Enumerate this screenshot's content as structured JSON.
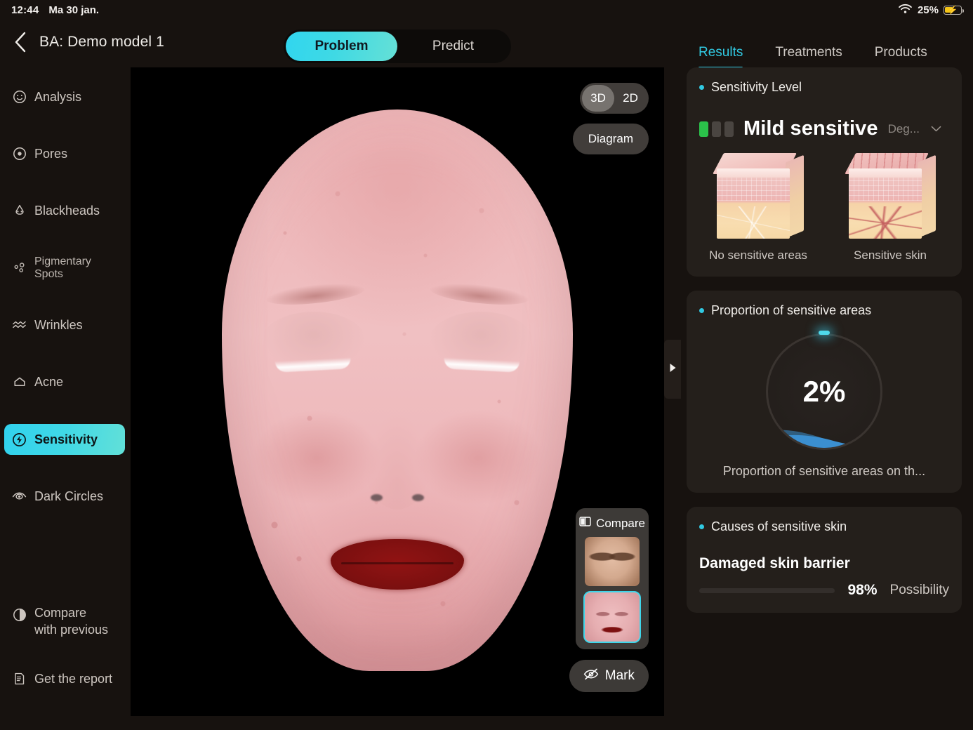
{
  "statusbar": {
    "time": "12:44",
    "date": "Ma 30 jan.",
    "battery_pct": "25%"
  },
  "header": {
    "title": "BA: Demo model 1",
    "back_icon": "chevron-left-icon",
    "segmented": [
      {
        "label": "Problem",
        "active": true
      },
      {
        "label": "Predict",
        "active": false
      }
    ]
  },
  "right_tabs": [
    {
      "label": "Results",
      "active": true
    },
    {
      "label": "Treatments",
      "active": false
    },
    {
      "label": "Products",
      "active": false
    }
  ],
  "sidebar": {
    "items": [
      {
        "label": "Analysis",
        "icon": "face-smile-icon",
        "selected": false
      },
      {
        "label": "Pores",
        "icon": "pore-circle-icon",
        "selected": false
      },
      {
        "label": "Blackheads",
        "icon": "nose-icon",
        "selected": false
      },
      {
        "label": "Pigmentary Spots",
        "icon": "spots-icon",
        "selected": false
      },
      {
        "label": "Wrinkles",
        "icon": "wavy-lines-icon",
        "selected": false
      },
      {
        "label": "Acne",
        "icon": "acne-bump-icon",
        "selected": false
      },
      {
        "label": "Sensitivity",
        "icon": "lightning-circle-icon",
        "selected": true
      },
      {
        "label": "Dark Circles",
        "icon": "eye-icon",
        "selected": false
      }
    ],
    "actions": [
      {
        "label_line1": "Compare",
        "label_line2": "with previous",
        "icon": "contrast-circle-icon"
      },
      {
        "label_line1": "Get the report",
        "label_line2": "",
        "icon": "document-icon"
      }
    ]
  },
  "viewer": {
    "dimension_toggle": [
      {
        "label": "3D",
        "active": true
      },
      {
        "label": "2D",
        "active": false
      }
    ],
    "diagram_button": "Diagram",
    "compare": {
      "title": "Compare",
      "icon": "compare-split-icon",
      "thumbnails": [
        {
          "name": "original-photo",
          "selected": false
        },
        {
          "name": "sensitivity-map",
          "selected": true
        }
      ]
    },
    "mark_button": {
      "label": "Mark",
      "icon": "eye-off-icon"
    },
    "collapse_handle_icon": "triangle-right-icon"
  },
  "results": {
    "sensitivity_level": {
      "title": "Sensitivity Level",
      "value": "Mild sensitive",
      "degree_label": "Deg...",
      "chevron": "chevron-down-icon",
      "level_blocks_total": 3,
      "level_blocks_active": 1,
      "active_color": "#2bc14a",
      "comparison": [
        {
          "caption": "No sensitive areas",
          "type": "normal"
        },
        {
          "caption": "Sensitive skin",
          "type": "sensitive"
        }
      ]
    },
    "proportion": {
      "title": "Proportion of sensitive areas",
      "value": "2%",
      "value_number": 2,
      "caption": "Proportion of sensitive areas on th...",
      "accent_color": "#4fd9ec",
      "wave_color": "#3b8fd0"
    },
    "causes": {
      "title": "Causes of sensitive skin",
      "items": [
        {
          "name": "Damaged skin barrier",
          "percent": "98%",
          "percent_value": 98,
          "label": "Possibility",
          "color": "#e8783c"
        }
      ]
    }
  }
}
